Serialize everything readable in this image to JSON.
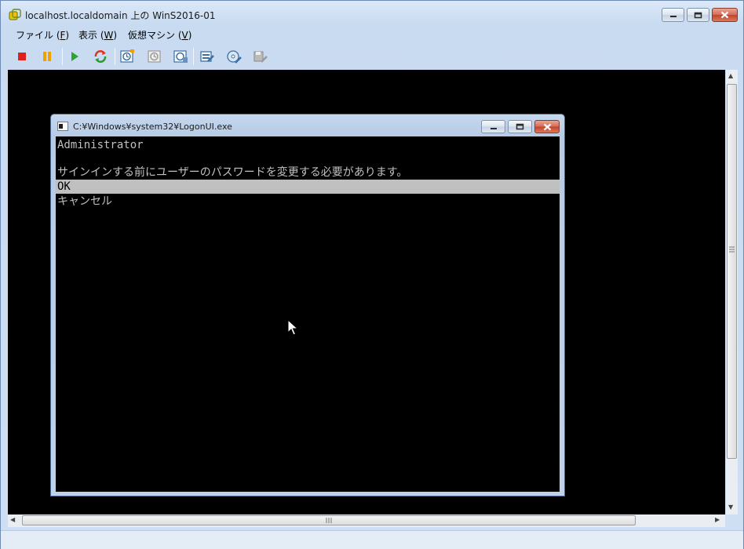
{
  "window": {
    "title": "localhost.localdomain 上の WinS2016-01"
  },
  "menu": [
    {
      "label": "ファイル (",
      "key": "F",
      "suffix": ")"
    },
    {
      "label": "表示 (",
      "key": "W",
      "suffix": ")"
    },
    {
      "label": "仮想マシン (",
      "key": "V",
      "suffix": ")"
    }
  ],
  "toolbar": {
    "icons": [
      "stop-icon",
      "pause-icon",
      "play-icon",
      "reset-icon",
      "snapshot-icon",
      "revert-snapshot-icon",
      "snapshot-manager-icon",
      "vm-settings-icon",
      "cd-drive-icon",
      "floppy-drive-icon"
    ]
  },
  "inner_window": {
    "title": "C:¥Windows¥system32¥LogonUI.exe",
    "lines": {
      "user": "Administrator",
      "message": "サインインする前にユーザーのパスワードを変更する必要があります。",
      "ok": "OK",
      "cancel": "キャンセル"
    }
  },
  "colors": {
    "console_bg": "#000000",
    "console_text": "#c0c0c0",
    "highlight_bg": "#c0c0c0"
  }
}
